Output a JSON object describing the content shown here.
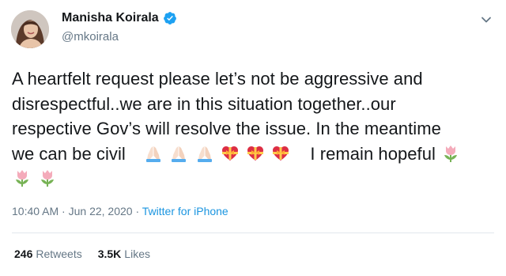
{
  "user": {
    "display_name": "Manisha Koirala",
    "handle": "@mkoirala"
  },
  "tweet": {
    "line1": "A heartfelt request please let’s not be aggressive and",
    "line2": "disrespectful..we are in this situation together..our",
    "line3": "respective Gov’s will resolve the issue. In the  meantime",
    "line4a": "we can be civil",
    "line4b": "I remain hopeful",
    "emojis": [
      "folded-hands-light",
      "folded-hands-light",
      "folded-hands-light",
      "heart-with-ribbon",
      "heart-with-ribbon",
      "heart-with-ribbon",
      "tulip",
      "tulip",
      "tulip"
    ]
  },
  "meta": {
    "time": "10:40 AM",
    "sep1": " · ",
    "date": "Jun 22, 2020",
    "sep2": " · ",
    "source": "Twitter for iPhone"
  },
  "stats": {
    "retweets_count": "246",
    "retweets_label": "Retweets",
    "likes_count": "3.5K",
    "likes_label": "Likes"
  },
  "colors": {
    "verified": "#1da1f2",
    "link": "#1b95e0",
    "muted": "#657786"
  }
}
